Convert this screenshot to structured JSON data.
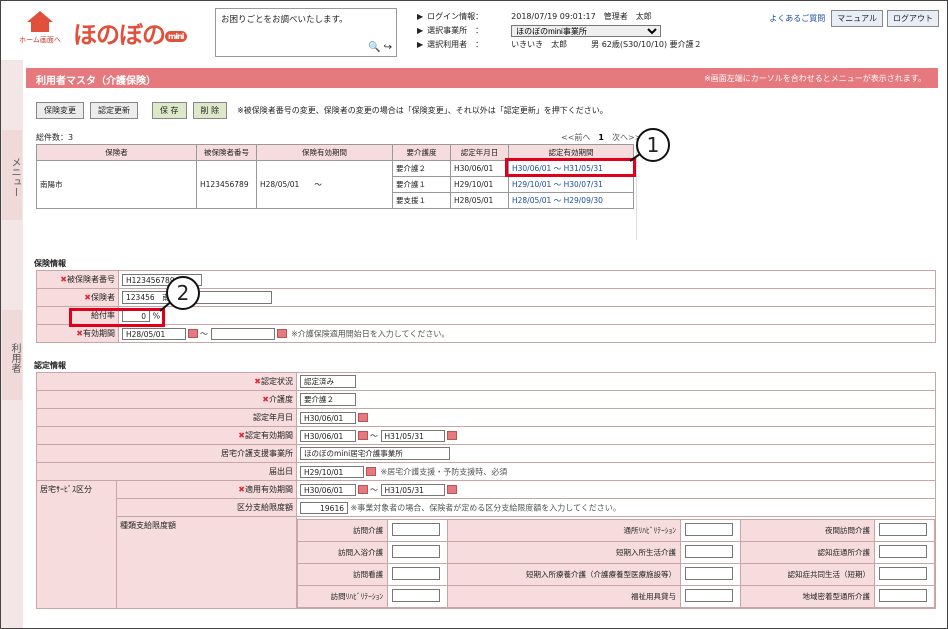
{
  "header": {
    "home_label": "ホーム画面へ",
    "logo": "ほのぼの",
    "logo_badge": "mini",
    "help_text": "お困りごとをお調べいたします。",
    "login_key": "ログイン情報：",
    "login_val": "2018/07/19 09:01:17　管理者　太郎",
    "office_key": "選択事業所　：",
    "office_val": "ほのぼのmini事業所",
    "user_key": "選択利用者　：",
    "user_val": "いきいき　太郎　　　男 62歳(S30/10/10) 要介護２",
    "faq": "よくあるご質問",
    "manual": "マニュアル",
    "logout": "ログアウト"
  },
  "side": {
    "menu": "メニュー",
    "user": "利用者"
  },
  "page": {
    "title": "利用者マスタ（介護保険）",
    "note": "※画面左端にカーソルを合わせるとメニューが表示されます。"
  },
  "buttons": {
    "change": "保険変更",
    "renew": "認定更新",
    "save": "保 存",
    "delete": "削 除",
    "msg": "※被保険者番号の変更、保険者の変更の場合は「保険変更」、それ以外は「認定更新」を押下ください。"
  },
  "list": {
    "total": "総件数：3",
    "pager_prev": "<<前へ",
    "page": "1",
    "pager_next": "次へ>>",
    "headers": [
      "保険者",
      "被保険者番号",
      "保険有効期間",
      "要介護度",
      "認定年月日",
      "認定有効期間"
    ],
    "insurer": "南陽市",
    "number": "H123456789",
    "period": "H28/05/01　　〜",
    "rows": [
      [
        "要介護２",
        "H30/06/01",
        "H30/06/01 〜 H31/05/31"
      ],
      [
        "要介護１",
        "H29/10/01",
        "H29/10/01 〜 H30/07/31"
      ],
      [
        "要支援１",
        "H28/05/01",
        "H28/05/01 〜 H29/09/30"
      ]
    ]
  },
  "insurance": {
    "section": "保険情報",
    "number_label": "被保険者番号",
    "number": "H123456789",
    "insurer_label": "保険者",
    "insurer": "123456　南",
    "rate_label": "給付率",
    "rate": "0",
    "rate_unit": "%",
    "period_label": "有効期間",
    "period_from": "H28/05/01",
    "tilde": "〜",
    "period_hint": "※介護保険適用開始日を入力してください。"
  },
  "cert": {
    "section": "認定情報",
    "status_label": "認定状況",
    "status": "認定済み",
    "level_label": "介護度",
    "level": "要介護２",
    "date_label": "認定年月日",
    "date": "H30/06/01",
    "period_label": "認定有効期間",
    "period_from": "H30/06/01",
    "period_to": "H31/05/31",
    "tilde": "〜",
    "office_label": "居宅介護支援事業所",
    "office": "ほのぼのmini居宅介護事業所",
    "notice_label": "届出日",
    "notice": "H29/10/01",
    "notice_hint": "※居宅介護支援・予防支援時、必須",
    "service_label": "居宅ｻｰﾋﾞｽ区分",
    "apply_label": "適用有効期間",
    "apply_from": "H30/06/01",
    "apply_to": "H31/05/31",
    "limit_label": "区分支給限度額",
    "limit": "19616",
    "limit_hint": "※事業対象者の場合、保険者が定める区分支給限度額を入力してください。",
    "kind_label": "種類支給限度額",
    "kinds": [
      [
        "訪問介護",
        "通所ﾘﾊﾋﾞﾘﾃｰｼｮﾝ",
        "夜間訪問介護"
      ],
      [
        "訪問入浴介護",
        "短期入所生活介護",
        "認知症通所介護"
      ],
      [
        "訪問看護",
        "短期入所療養介護（介護療養型医療施設等）",
        "認知症共同生活（短期）"
      ],
      [
        "訪問ﾘﾊﾋﾞﾘﾃｰｼｮﾝ",
        "福祉用具貸与",
        "地域密着型通所介護"
      ]
    ]
  },
  "callouts": [
    "1",
    "2"
  ]
}
